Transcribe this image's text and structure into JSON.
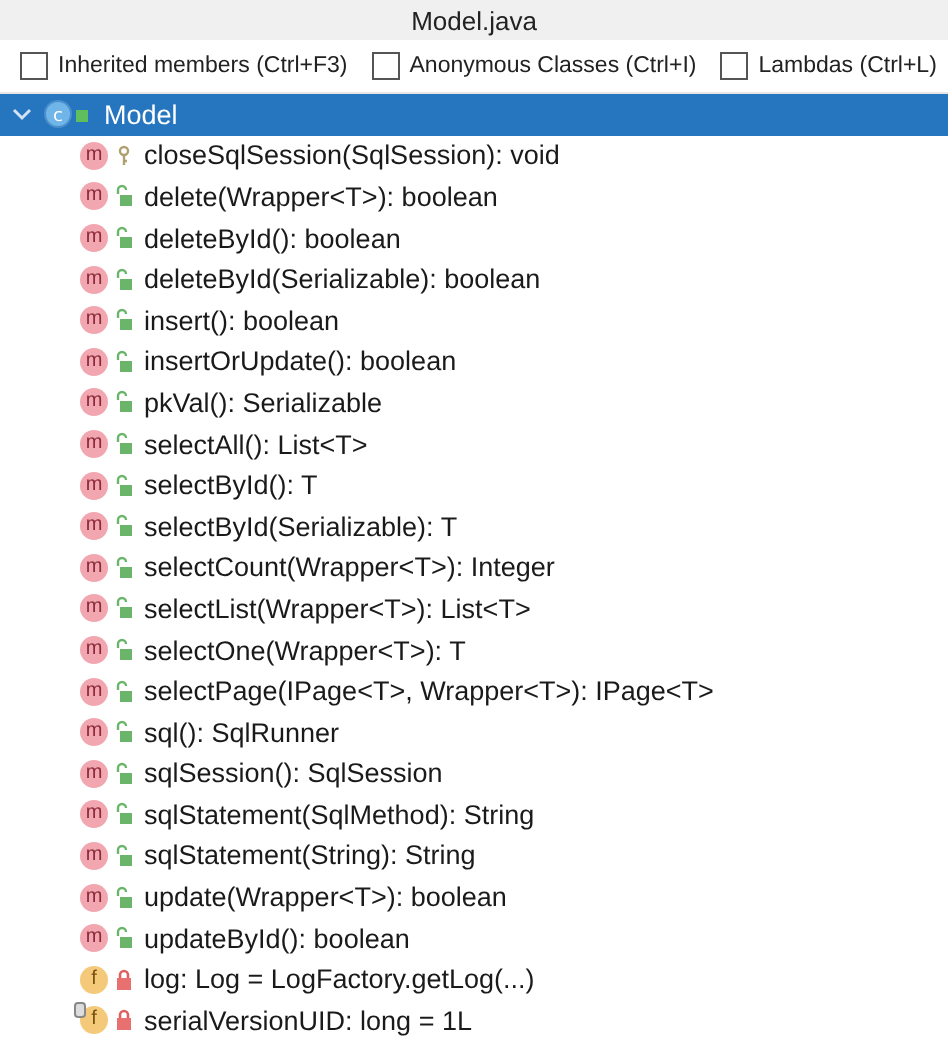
{
  "window": {
    "title": "Model.java"
  },
  "toolbar": {
    "options": [
      {
        "label": "Inherited members (Ctrl+F3)",
        "checked": false
      },
      {
        "label": "Anonymous Classes (Ctrl+I)",
        "checked": false
      },
      {
        "label": "Lambdas (Ctrl+L)",
        "checked": false
      }
    ]
  },
  "tree": {
    "root": {
      "icon": "c",
      "label": "Model",
      "expanded": true,
      "selected": true
    },
    "children": [
      {
        "kind": "protected",
        "icon": "m",
        "static": false,
        "label": "closeSqlSession(SqlSession): void"
      },
      {
        "kind": "public",
        "icon": "m",
        "static": false,
        "label": "delete(Wrapper<T>): boolean"
      },
      {
        "kind": "public",
        "icon": "m",
        "static": false,
        "label": "deleteById(): boolean"
      },
      {
        "kind": "public",
        "icon": "m",
        "static": false,
        "label": "deleteById(Serializable): boolean"
      },
      {
        "kind": "public",
        "icon": "m",
        "static": false,
        "label": "insert(): boolean"
      },
      {
        "kind": "public",
        "icon": "m",
        "static": false,
        "label": "insertOrUpdate(): boolean"
      },
      {
        "kind": "public",
        "icon": "m",
        "static": false,
        "label": "pkVal(): Serializable"
      },
      {
        "kind": "public",
        "icon": "m",
        "static": false,
        "label": "selectAll(): List<T>"
      },
      {
        "kind": "public",
        "icon": "m",
        "static": false,
        "label": "selectById(): T"
      },
      {
        "kind": "public",
        "icon": "m",
        "static": false,
        "label": "selectById(Serializable): T"
      },
      {
        "kind": "public",
        "icon": "m",
        "static": false,
        "label": "selectCount(Wrapper<T>): Integer"
      },
      {
        "kind": "public",
        "icon": "m",
        "static": false,
        "label": "selectList(Wrapper<T>): List<T>"
      },
      {
        "kind": "public",
        "icon": "m",
        "static": false,
        "label": "selectOne(Wrapper<T>): T"
      },
      {
        "kind": "public",
        "icon": "m",
        "static": false,
        "label": "selectPage(IPage<T>, Wrapper<T>): IPage<T>"
      },
      {
        "kind": "public",
        "icon": "m",
        "static": false,
        "label": "sql(): SqlRunner"
      },
      {
        "kind": "public",
        "icon": "m",
        "static": false,
        "label": "sqlSession(): SqlSession"
      },
      {
        "kind": "public",
        "icon": "m",
        "static": false,
        "label": "sqlStatement(SqlMethod): String"
      },
      {
        "kind": "public",
        "icon": "m",
        "static": false,
        "label": "sqlStatement(String): String"
      },
      {
        "kind": "public",
        "icon": "m",
        "static": false,
        "label": "update(Wrapper<T>): boolean"
      },
      {
        "kind": "public",
        "icon": "m",
        "static": false,
        "label": "updateById(): boolean"
      },
      {
        "kind": "private",
        "icon": "f",
        "static": false,
        "label": "log: Log = LogFactory.getLog(...)"
      },
      {
        "kind": "private",
        "icon": "f",
        "static": true,
        "label": "serialVersionUID: long = 1L"
      }
    ]
  }
}
